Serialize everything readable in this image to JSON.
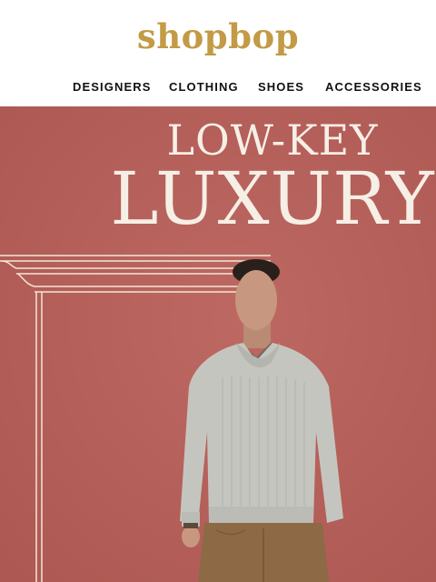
{
  "header": {
    "logo_text": "shopbop",
    "nav": [
      {
        "label": "DESIGNERS"
      },
      {
        "label": "CLOTHING"
      },
      {
        "label": "SHOES"
      },
      {
        "label": "ACCESSORIES"
      }
    ]
  },
  "hero": {
    "headline_line1": "LOW-KEY",
    "headline_line2": "LUXURY"
  },
  "colors": {
    "brand_gold": "#c39a45",
    "hero_background": "#b8625b",
    "headline_text": "#f6efe6"
  }
}
